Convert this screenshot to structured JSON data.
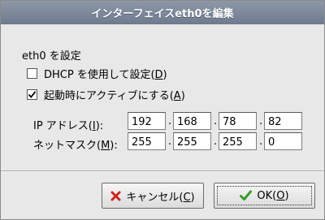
{
  "window": {
    "title": "インターフェイスeth0を編集"
  },
  "section_label": "eth0 を設定",
  "dhcp": {
    "label_pre": "DHCP を使用して設定(",
    "key": "D",
    "label_post": ")",
    "checked": false
  },
  "activate": {
    "label_pre": "起動時にアクティブにする(",
    "key": "A",
    "label_post": ")",
    "checked": true
  },
  "ip": {
    "label_pre": "IP アドレス(",
    "key": "I",
    "label_post": "):",
    "octets": [
      "192",
      "168",
      "78",
      "82"
    ]
  },
  "mask": {
    "label_pre": "ネットマスク(",
    "key": "M",
    "label_post": "):",
    "octets": [
      "255",
      "255",
      "255",
      "0"
    ]
  },
  "dot": ".",
  "buttons": {
    "cancel": {
      "label_pre": "キャンセル(",
      "key": "C",
      "label_post": ")",
      "icon": "cancel-x-icon",
      "icon_color": "#cc2222"
    },
    "ok": {
      "label_pre": "OK(",
      "key": "O",
      "label_post": ")",
      "icon": "ok-check-icon",
      "icon_color": "#3a9a2a"
    }
  }
}
